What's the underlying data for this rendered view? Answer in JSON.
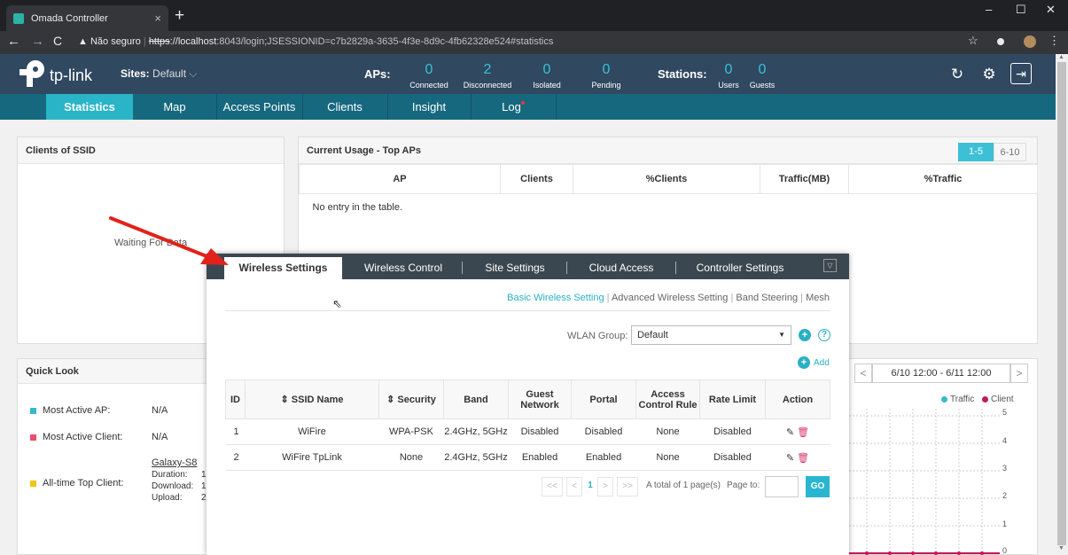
{
  "browser": {
    "tab_title": "Omada Controller",
    "tab_close": "×",
    "new_tab": "+",
    "url_warning": "Não seguro",
    "url_scheme": "https",
    "url_host": "://localhost",
    "url_rest": ":8043/login;JSESSIONID=c7b2829a-3635-4f3e-8d9c-4fb62328e524#statistics",
    "minimize": "–",
    "maximize": "☐",
    "close": "✕"
  },
  "header": {
    "logo_text": "tp-link",
    "sites_label": "Sites:",
    "sites_value": "Default",
    "aps_label": "APs:",
    "aps": [
      {
        "value": "0",
        "label": "Connected"
      },
      {
        "value": "2",
        "label": "Disconnected"
      },
      {
        "value": "0",
        "label": "Isolated"
      },
      {
        "value": "0",
        "label": "Pending"
      }
    ],
    "stations_label": "Stations:",
    "stations": [
      {
        "value": "0",
        "label": "Users"
      },
      {
        "value": "0",
        "label": "Guests"
      }
    ]
  },
  "nav": {
    "items": [
      "Statistics",
      "Map",
      "Access Points",
      "Clients",
      "Insight",
      "Log"
    ],
    "active": "Statistics"
  },
  "clients_ssid": {
    "title": "Clients of SSID",
    "waiting": "Waiting For Data"
  },
  "usage": {
    "title": "Current Usage - Top APs",
    "pages": [
      "1-5",
      "6-10"
    ],
    "columns": [
      "AP",
      "Clients",
      "%Clients",
      "Traffic(MB)",
      "%Traffic"
    ],
    "empty": "No entry in the table."
  },
  "quick_look": {
    "title": "Quick Look",
    "items": [
      {
        "label": "Most Active AP:",
        "value": "N/A",
        "color": "#36b9cc"
      },
      {
        "label": "Most Active Client:",
        "value": "N/A",
        "color": "#e8506a"
      },
      {
        "label": "All-time Top Client:",
        "value": "",
        "color": "#f0c419"
      }
    ],
    "top_client": {
      "name": "Galaxy-S8",
      "duration_label": "Duration:",
      "duration_value": "1",
      "download_label": "Download:",
      "download_value": "1",
      "upload_label": "Upload:",
      "upload_value": "2"
    }
  },
  "traffic_chart": {
    "range": "6/10 12:00 - 6/11 12:00",
    "prev": "<",
    "next": ">",
    "legend": [
      {
        "name": "Traffic",
        "color": "#36b9cc"
      },
      {
        "name": "Client",
        "color": "#c2185b"
      }
    ],
    "y_ticks": [
      "5",
      "4",
      "3",
      "2",
      "1",
      "0"
    ]
  },
  "modal": {
    "tabs": [
      "Wireless Settings",
      "Wireless Control",
      "Site Settings",
      "Cloud Access",
      "Controller Settings"
    ],
    "active_tab": "Wireless Settings",
    "subnav": [
      "Basic Wireless Setting",
      "Advanced Wireless Setting",
      "Band Steering",
      "Mesh"
    ],
    "wlan_group_label": "WLAN Group:",
    "wlan_group_value": "Default",
    "add_label": "Add",
    "table": {
      "columns": [
        "ID",
        "SSID Name",
        "Security",
        "Band",
        "Guest Network",
        "Portal",
        "Access Control Rule",
        "Rate Limit",
        "Action"
      ],
      "rows": [
        {
          "id": "1",
          "ssid": "WiFire",
          "security": "WPA-PSK",
          "band": "2.4GHz, 5GHz",
          "guest": "Disabled",
          "portal": "Disabled",
          "acl": "None",
          "rate": "Disabled"
        },
        {
          "id": "2",
          "ssid": "WiFire TpLink",
          "security": "None",
          "band": "2.4GHz, 5GHz",
          "guest": "Enabled",
          "portal": "Enabled",
          "acl": "None",
          "rate": "Disabled"
        }
      ]
    },
    "pager": {
      "first": "<<",
      "prev": "<",
      "current": "1",
      "next": ">",
      "last": ">>",
      "total": "A total of 1 page(s)",
      "page_to": "Page to:",
      "go": "GO"
    }
  },
  "colors": {
    "accent": "#29b4c8",
    "header_bg": "#304860",
    "nav_bg": "#16687e"
  }
}
